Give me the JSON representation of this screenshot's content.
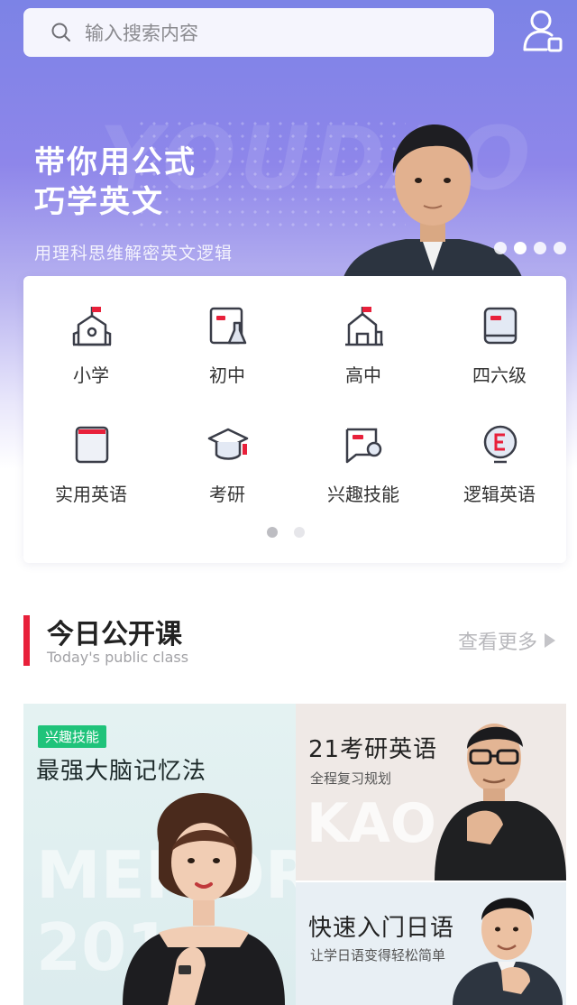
{
  "search": {
    "placeholder": "输入搜索内容"
  },
  "banner": {
    "title_line1": "带你用公式",
    "title_line2": "巧学英文",
    "subtitle": "用理科思维解密英文逻辑",
    "watermark": "YOUDAO",
    "slides": 4,
    "active_slide": 1
  },
  "categories": {
    "items": [
      {
        "label": "小学",
        "icon": "school-icon"
      },
      {
        "label": "初中",
        "icon": "science-board-icon"
      },
      {
        "label": "高中",
        "icon": "building-icon"
      },
      {
        "label": "四六级",
        "icon": "book-icon"
      },
      {
        "label": "实用英语",
        "icon": "notebook-icon"
      },
      {
        "label": "考研",
        "icon": "graduation-cap-icon"
      },
      {
        "label": "兴趣技能",
        "icon": "chat-flag-icon"
      },
      {
        "label": "逻辑英语",
        "icon": "letter-e-icon"
      }
    ],
    "pages": 2,
    "active_page": 1
  },
  "section": {
    "title": "今日公开课",
    "subtitle": "Today's public class",
    "more_label": "查看更多"
  },
  "courses": {
    "left": {
      "tag": "兴趣技能",
      "title": "最强大脑记忆法",
      "bg_text_1": "MEMOR",
      "bg_text_2": "201"
    },
    "right_top": {
      "title": "21考研英语",
      "subtitle": "全程复习规划",
      "bg_text": "KAO"
    },
    "right_bottom": {
      "title": "快速入门日语",
      "subtitle": "让学日语变得轻松简单"
    }
  },
  "colors": {
    "accent_red": "#e8203a",
    "tag_green": "#1fc37a",
    "hero_purple": "#7c83e6"
  }
}
